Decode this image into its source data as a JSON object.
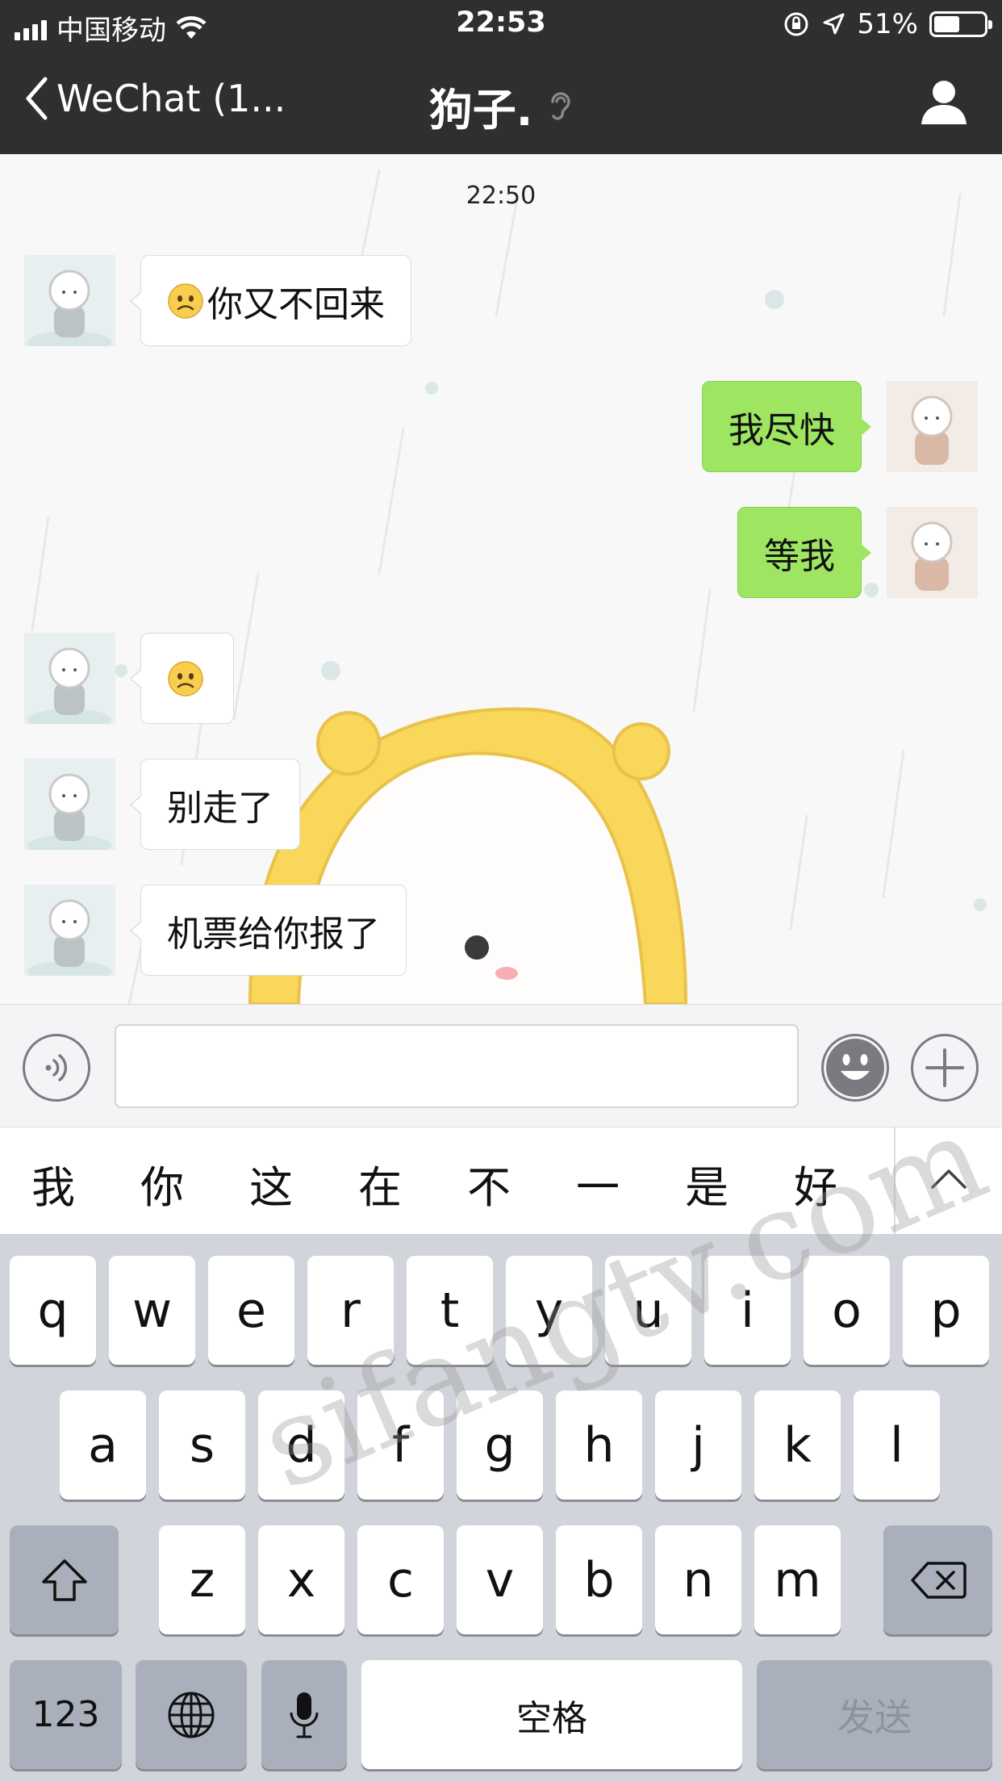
{
  "status_bar": {
    "carrier": "中国移动",
    "time": "22:53",
    "battery_percent": "51%",
    "battery_level": 0.51
  },
  "nav": {
    "back_label": "WeChat (1...",
    "title": "狗子."
  },
  "chat": {
    "timestamp": "22:50",
    "messages": [
      {
        "side": "in",
        "emoji": "frowning-face",
        "text": "你又不回来"
      },
      {
        "side": "out",
        "text": "我尽快"
      },
      {
        "side": "out",
        "text": "等我"
      },
      {
        "side": "in",
        "emoji": "frowning-face",
        "text": ""
      },
      {
        "side": "in",
        "text": "别走了"
      },
      {
        "side": "in",
        "text": "机票给你报了"
      }
    ]
  },
  "input": {
    "value": "",
    "voice_icon": "voice-icon",
    "emoji_icon": "smiley-icon",
    "more_icon": "plus-icon"
  },
  "candidates": [
    "我",
    "你",
    "这",
    "在",
    "不",
    "一",
    "是",
    "好"
  ],
  "keyboard": {
    "row1": [
      "q",
      "w",
      "e",
      "r",
      "t",
      "y",
      "u",
      "i",
      "o",
      "p"
    ],
    "row2": [
      "a",
      "s",
      "d",
      "f",
      "g",
      "h",
      "j",
      "k",
      "l"
    ],
    "row3": [
      "z",
      "x",
      "c",
      "v",
      "b",
      "n",
      "m"
    ],
    "numbers_label": "123",
    "space_label": "空格",
    "send_label": "发送"
  },
  "watermark": "sifangtv.com",
  "colors": {
    "nav_bg": "#2f2f31",
    "outgoing_bubble": "#9ee562",
    "incoming_bubble": "#ffffff",
    "keyboard_bg": "#d1d4da"
  }
}
